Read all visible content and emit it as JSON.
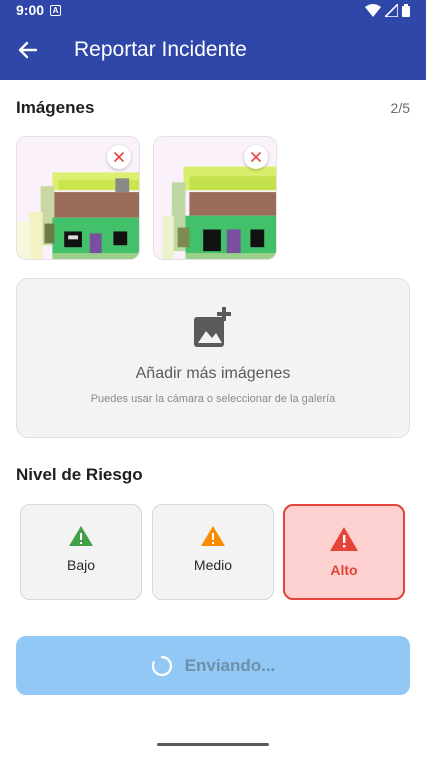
{
  "status_bar": {
    "time": "9:00",
    "notif_letter": "A"
  },
  "app_bar": {
    "back_icon": "arrow-left-icon",
    "title": "Reportar Incidente"
  },
  "images_section": {
    "title": "Imágenes",
    "counter": "2/5",
    "thumbnails": [
      {
        "remove_icon": "close-icon"
      },
      {
        "remove_icon": "close-icon"
      }
    ],
    "add": {
      "icon": "add-photo-icon",
      "title": "Añadir más imágenes",
      "subtitle": "Puedes usar la cámara o seleccionar de la galería"
    }
  },
  "risk_section": {
    "title": "Nivel de Riesgo",
    "options": [
      {
        "label": "Bajo",
        "color": "#43a047",
        "icon": "warning-icon",
        "selected": false
      },
      {
        "label": "Medio",
        "color": "#fb8c00",
        "icon": "warning-icon",
        "selected": false
      },
      {
        "label": "Alto",
        "color": "#e5443a",
        "icon": "warning-icon",
        "selected": true
      }
    ]
  },
  "submit": {
    "label": "Enviando...",
    "icon": "loading-spinner-icon"
  },
  "colors": {
    "primary": "#2e47a8",
    "submit_bg": "#92c8f6",
    "selected_bg": "#fcd1d0",
    "selected_border": "#e5443a"
  }
}
